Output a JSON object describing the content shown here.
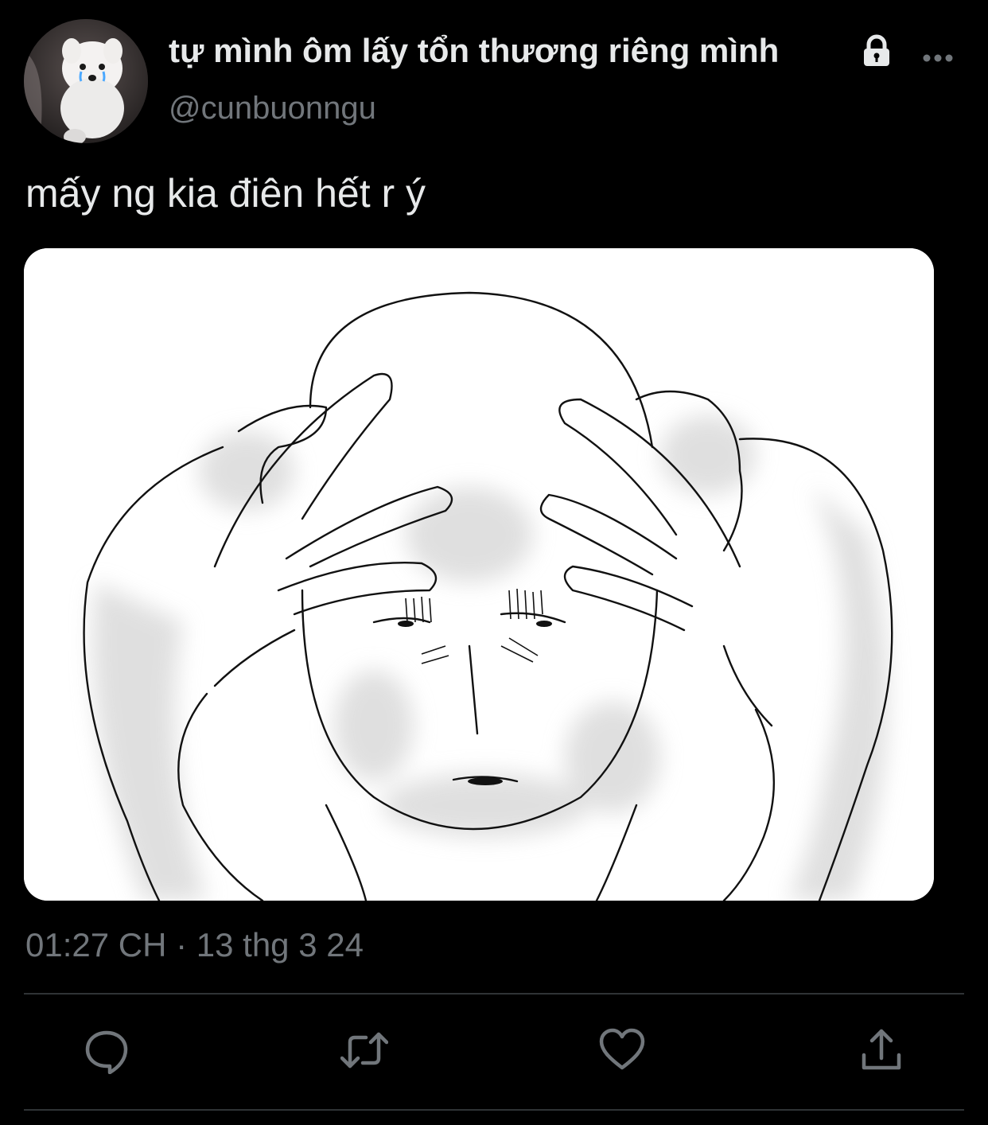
{
  "author": {
    "display_name": "tự mình ôm lấy tổn thương riêng mình",
    "handle": "@cunbuonngu",
    "avatar_icon": "samoyed-avatar",
    "protected_icon": "lock-icon"
  },
  "tweet": {
    "text": "mấy ng kia điên hết r ý",
    "timestamp": "01:27 CH · 13 thg 3 24",
    "media_icon": "stressed-man-drawing"
  },
  "actions": [
    {
      "name": "reply",
      "icon": "reply-icon"
    },
    {
      "name": "retweet",
      "icon": "retweet-icon"
    },
    {
      "name": "like",
      "icon": "heart-icon"
    },
    {
      "name": "share",
      "icon": "share-icon"
    }
  ],
  "colors": {
    "background": "#000000",
    "text": "#e7e9ea",
    "secondary_text": "#71767b",
    "divider": "#2f3336"
  }
}
